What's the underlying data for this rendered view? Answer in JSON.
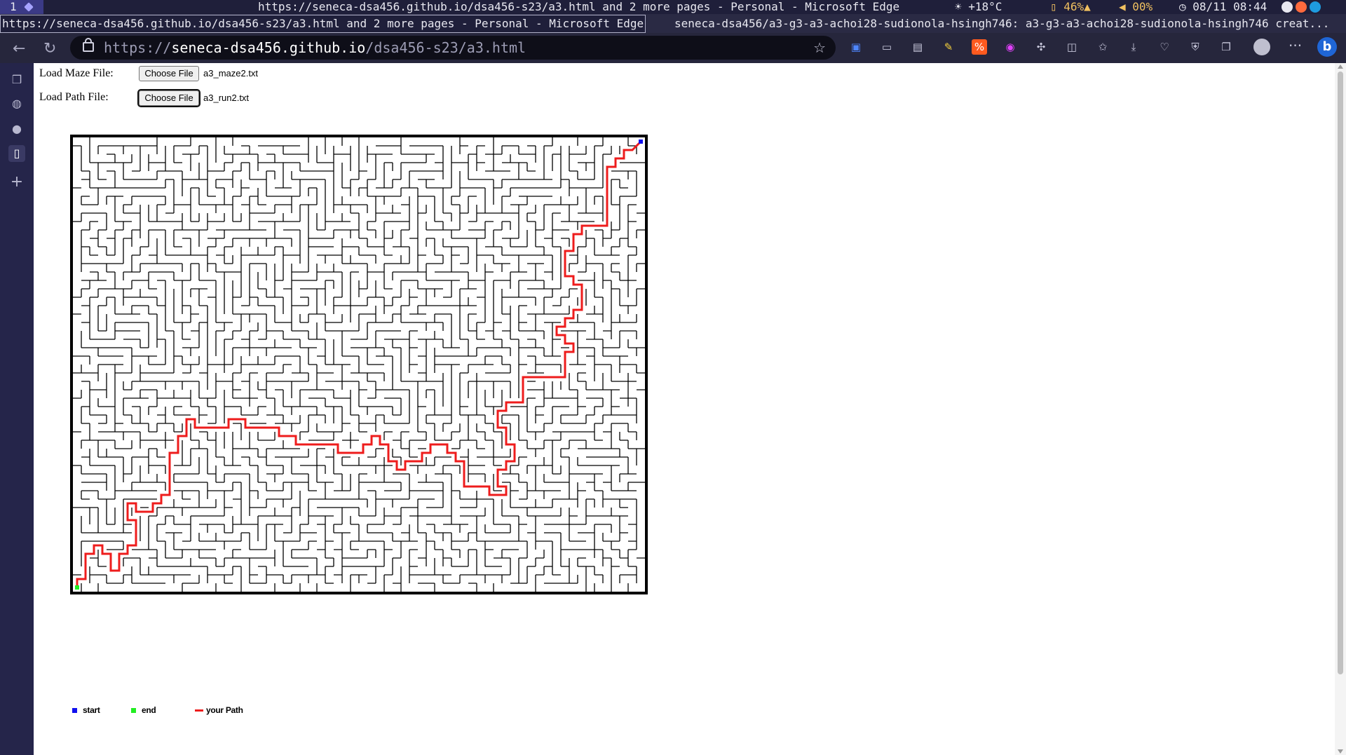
{
  "system_bar": {
    "workspace": "1",
    "window_title": "https://seneca-dsa456.github.io/dsa456-s23/a3.html and 2 more pages - Personal - Microsoft Edge",
    "weather": "☀  +18°C",
    "battery": "▯ 46%▲",
    "volume": "◀ 00%",
    "clock": "◷ 08/11 08:44"
  },
  "tabs": [
    {
      "label": "https://seneca-dsa456.github.io/dsa456-s23/a3.html and 2 more pages - Personal - Microsoft Edge"
    },
    {
      "label": "seneca-dsa456/a3-g3-a3-achoi28-sudionola-hsingh746: a3-g3-a3-achoi28-sudionola-hsingh746 creat..."
    }
  ],
  "address_bar": {
    "scheme": "https://",
    "host": "seneca-dsa456.github.io",
    "path": "/dsa456-s23/a3.html"
  },
  "toolbar_icons": [
    "bitwarden-icon",
    "screencast-icon",
    "media-icon",
    "pen-icon",
    "percent-icon",
    "color-icon",
    "extensions-icon",
    "split-screen-icon",
    "favorites-icon",
    "downloads-icon",
    "performance-icon",
    "browser-essentials-icon",
    "collections-icon"
  ],
  "form": {
    "maze_label": "Load Maze File:",
    "maze_button": "Choose File",
    "maze_file": "a3_maze2.txt",
    "path_label": "Load Path File:",
    "path_button": "Choose File",
    "path_file": "a3_run2.txt"
  },
  "legend": {
    "start": "start",
    "end": "end",
    "path": "your Path"
  },
  "colors": {
    "start": "#1010ee",
    "end": "#22ee22",
    "path": "#ee1c1c",
    "wall": "#000000"
  },
  "maze": {
    "cols": 68,
    "rows": 54,
    "start_cell": [
      67,
      0
    ],
    "end_cell": [
      0,
      53
    ],
    "path": [
      [
        67,
        0
      ],
      [
        66,
        1
      ],
      [
        65,
        1
      ],
      [
        65,
        2
      ],
      [
        64,
        2
      ],
      [
        64,
        3
      ],
      [
        63,
        3
      ],
      [
        63,
        4
      ],
      [
        63,
        5
      ],
      [
        63,
        6
      ],
      [
        63,
        7
      ],
      [
        63,
        8
      ],
      [
        63,
        9
      ],
      [
        63,
        10
      ],
      [
        60,
        10
      ],
      [
        60,
        11
      ],
      [
        59,
        11
      ],
      [
        59,
        12
      ],
      [
        59,
        13
      ],
      [
        58,
        13
      ],
      [
        58,
        14
      ],
      [
        58,
        15
      ],
      [
        58,
        16
      ],
      [
        59,
        16
      ],
      [
        59,
        17
      ],
      [
        60,
        17
      ],
      [
        60,
        18
      ],
      [
        60,
        19
      ],
      [
        60,
        20
      ],
      [
        59,
        20
      ],
      [
        59,
        21
      ],
      [
        58,
        21
      ],
      [
        58,
        22
      ],
      [
        57,
        22
      ],
      [
        57,
        23
      ],
      [
        58,
        23
      ],
      [
        58,
        24
      ],
      [
        59,
        24
      ],
      [
        59,
        25
      ],
      [
        58,
        25
      ],
      [
        58,
        26
      ],
      [
        58,
        27
      ],
      [
        58,
        28
      ],
      [
        57,
        28
      ],
      [
        56,
        28
      ],
      [
        53,
        28
      ],
      [
        53,
        29
      ],
      [
        53,
        30
      ],
      [
        53,
        31
      ],
      [
        51,
        31
      ],
      [
        51,
        32
      ],
      [
        50,
        32
      ],
      [
        50,
        33
      ],
      [
        50,
        34
      ],
      [
        51,
        34
      ],
      [
        51,
        35
      ],
      [
        51,
        36
      ],
      [
        52,
        36
      ],
      [
        52,
        37
      ],
      [
        52,
        38
      ],
      [
        51,
        38
      ],
      [
        51,
        39
      ],
      [
        50,
        39
      ],
      [
        50,
        40
      ],
      [
        50,
        41
      ],
      [
        51,
        41
      ],
      [
        51,
        42
      ],
      [
        49,
        42
      ],
      [
        49,
        41
      ],
      [
        47,
        41
      ],
      [
        46,
        41
      ],
      [
        46,
        40
      ],
      [
        46,
        39
      ],
      [
        46,
        38
      ],
      [
        45,
        38
      ],
      [
        45,
        37
      ],
      [
        44,
        37
      ],
      [
        44,
        36
      ],
      [
        43,
        36
      ],
      [
        42,
        36
      ],
      [
        42,
        37
      ],
      [
        41,
        37
      ],
      [
        41,
        38
      ],
      [
        40,
        38
      ],
      [
        39,
        38
      ],
      [
        39,
        39
      ],
      [
        38,
        39
      ],
      [
        38,
        38
      ],
      [
        37,
        38
      ],
      [
        37,
        37
      ],
      [
        37,
        36
      ],
      [
        36,
        36
      ],
      [
        36,
        35
      ],
      [
        35,
        35
      ],
      [
        35,
        36
      ],
      [
        34,
        36
      ],
      [
        34,
        37
      ],
      [
        32,
        37
      ],
      [
        31,
        37
      ],
      [
        31,
        36
      ],
      [
        29,
        36
      ],
      [
        27,
        36
      ],
      [
        26,
        36
      ],
      [
        26,
        35
      ],
      [
        24,
        35
      ],
      [
        24,
        34
      ],
      [
        23,
        34
      ],
      [
        22,
        34
      ],
      [
        21,
        34
      ],
      [
        20,
        34
      ],
      [
        20,
        33
      ],
      [
        19,
        33
      ],
      [
        18,
        33
      ],
      [
        18,
        34
      ],
      [
        16,
        34
      ],
      [
        15,
        34
      ],
      [
        14,
        34
      ],
      [
        14,
        33
      ],
      [
        13,
        33
      ],
      [
        13,
        34
      ],
      [
        13,
        35
      ],
      [
        12,
        35
      ],
      [
        12,
        36
      ],
      [
        12,
        37
      ],
      [
        11,
        37
      ],
      [
        11,
        38
      ],
      [
        11,
        39
      ],
      [
        11,
        40
      ],
      [
        11,
        41
      ],
      [
        11,
        42
      ],
      [
        10,
        42
      ],
      [
        10,
        43
      ],
      [
        9,
        43
      ],
      [
        9,
        44
      ],
      [
        7,
        44
      ],
      [
        7,
        43
      ],
      [
        6,
        43
      ],
      [
        6,
        44
      ],
      [
        6,
        45
      ],
      [
        7,
        45
      ],
      [
        7,
        46
      ],
      [
        7,
        47
      ],
      [
        7,
        48
      ],
      [
        6,
        48
      ],
      [
        6,
        49
      ],
      [
        5,
        49
      ],
      [
        5,
        50
      ],
      [
        5,
        51
      ],
      [
        4,
        51
      ],
      [
        4,
        50
      ],
      [
        4,
        49
      ],
      [
        3,
        49
      ],
      [
        3,
        48
      ],
      [
        2,
        48
      ],
      [
        2,
        49
      ],
      [
        1,
        49
      ],
      [
        1,
        50
      ],
      [
        1,
        51
      ],
      [
        1,
        52
      ],
      [
        0,
        52
      ],
      [
        0,
        53
      ]
    ]
  }
}
